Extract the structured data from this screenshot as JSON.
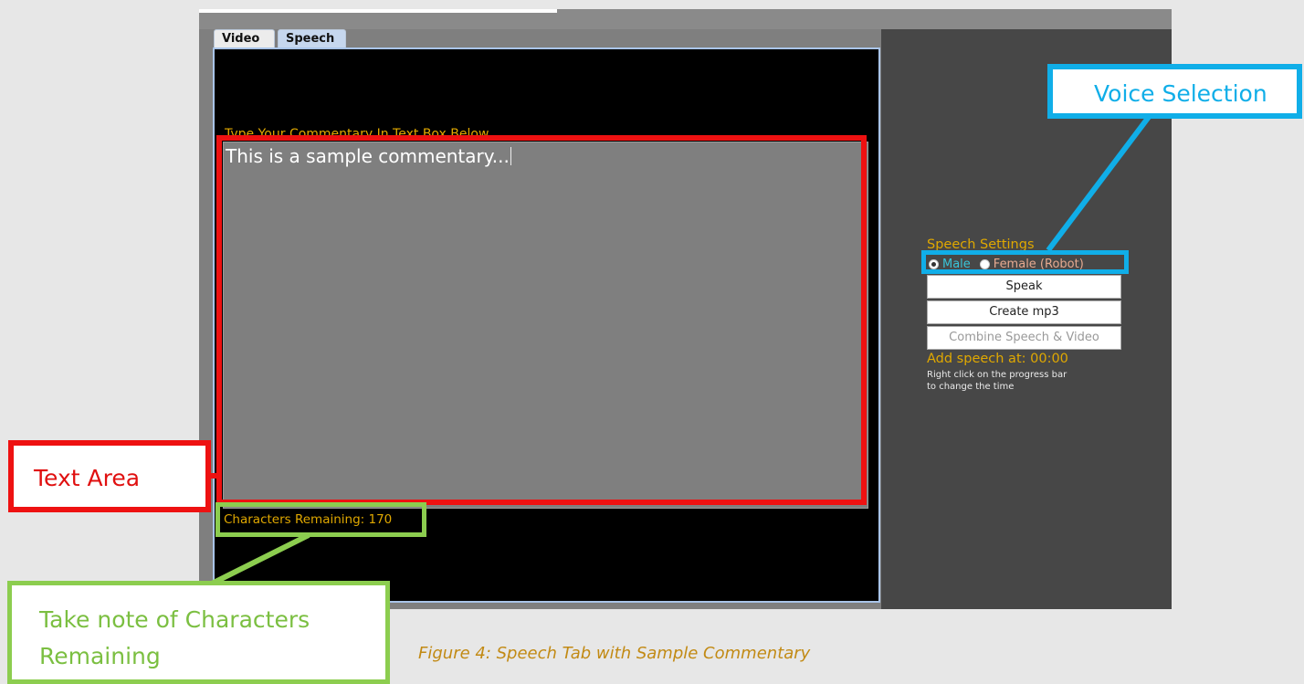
{
  "tabs": [
    {
      "label": "Video",
      "active": false
    },
    {
      "label": "Speech",
      "active": true
    }
  ],
  "speech_panel": {
    "instruction_label": "Type Your Commentary In Text Box Below",
    "commentary_text": "This is a sample commentary...",
    "characters_remaining": "Characters Remaining: 170"
  },
  "settings": {
    "title": "Speech Settings",
    "voice_options": [
      {
        "label": "Male",
        "selected": true
      },
      {
        "label": "Female (Robot)",
        "selected": false
      }
    ],
    "speak_button": "Speak",
    "create_mp3_button": "Create mp3",
    "combine_button": "Combine Speech & Video",
    "add_speech_at": "Add speech at: 00:00",
    "hint_line1": "Right click on the progress bar",
    "hint_line2": "to change the time"
  },
  "annotations": {
    "text_area": "Text Area",
    "voice_selection": "Voice Selection",
    "characters_note_line1": "Take note of Characters",
    "characters_note_line2": "Remaining"
  },
  "caption": "Figure 4: Speech Tab with Sample Commentary",
  "colors": {
    "text_area_annotation": "#ee1111",
    "voice_annotation": "#10aee8",
    "characters_annotation": "#8ccd4f",
    "label_gold": "#e0a800"
  }
}
